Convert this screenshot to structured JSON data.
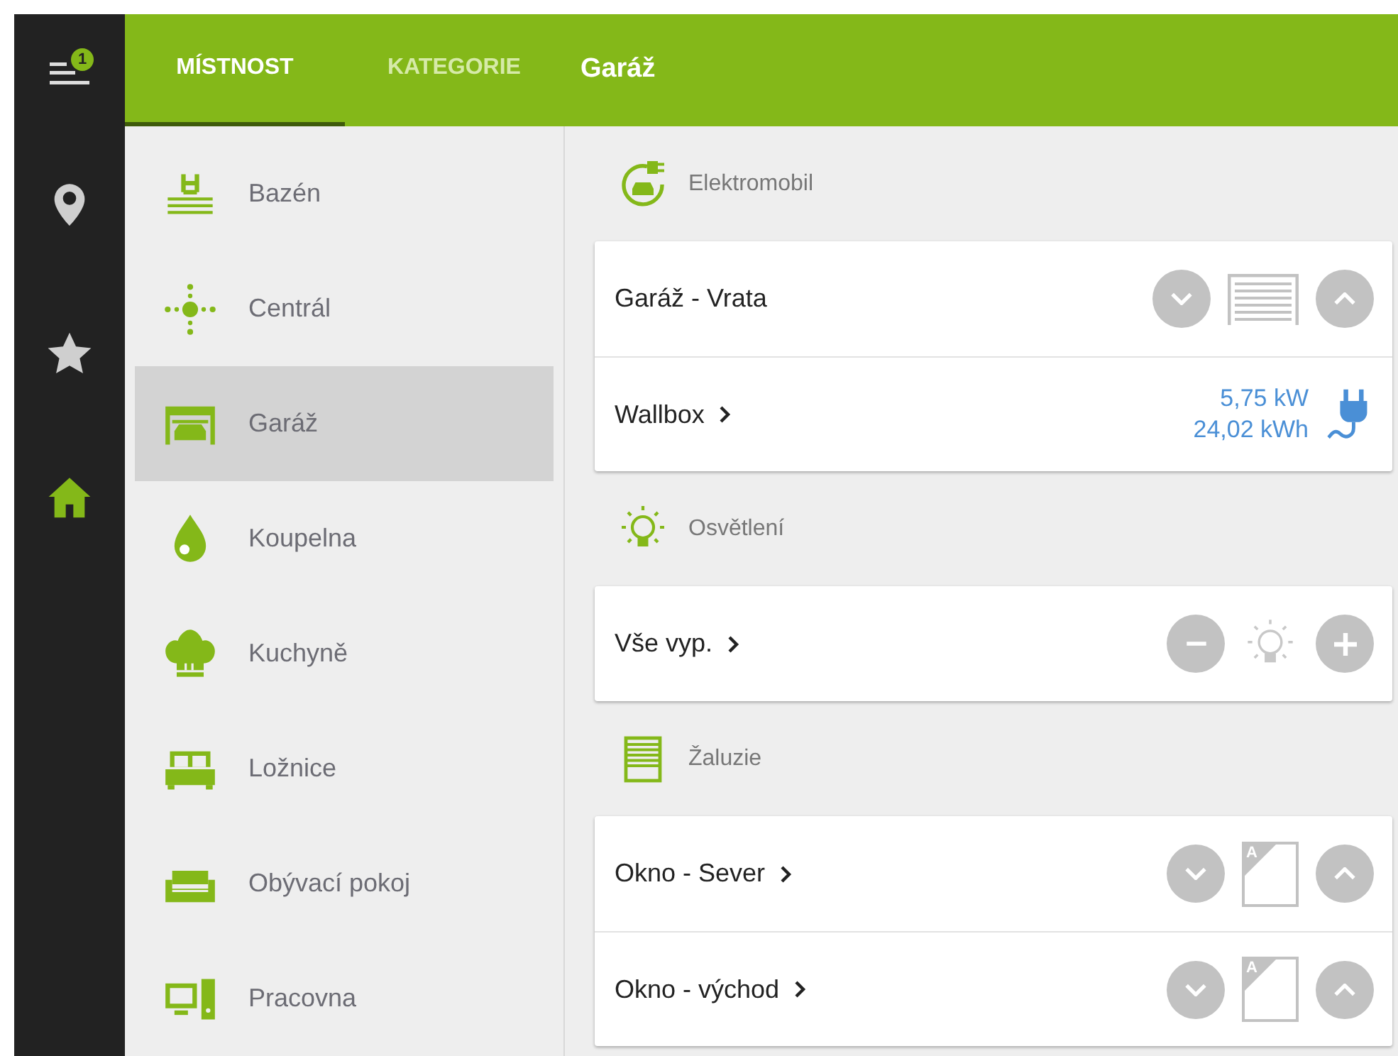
{
  "nav": {
    "badge": "1",
    "items": [
      {
        "selected": false
      },
      {
        "selected": false
      },
      {
        "selected": true
      }
    ]
  },
  "tabs": [
    {
      "label": "MÍSTNOST",
      "selected": true
    },
    {
      "label": "KATEGORIE",
      "selected": false
    }
  ],
  "title": "Garáž",
  "rooms": [
    {
      "label": "Bazén",
      "selected": false
    },
    {
      "label": "Centrál",
      "selected": false
    },
    {
      "label": "Garáž",
      "selected": true
    },
    {
      "label": "Koupelna",
      "selected": false
    },
    {
      "label": "Kuchyně",
      "selected": false
    },
    {
      "label": "Ložnice",
      "selected": false
    },
    {
      "label": "Obývací pokoj",
      "selected": false
    },
    {
      "label": "Pracovna",
      "selected": false
    }
  ],
  "sections": [
    {
      "title": "Elektromobil",
      "rows": [
        {
          "kind": "gate",
          "label": "Garáž - Vrata",
          "link": false
        },
        {
          "kind": "meter",
          "label": "Wallbox",
          "link": true,
          "readings": [
            "5,75 kW",
            "24,02 kWh"
          ]
        }
      ]
    },
    {
      "title": "Osvětlení",
      "rows": [
        {
          "kind": "light",
          "label": "Vše vyp.",
          "link": true
        }
      ]
    },
    {
      "title": "Žaluzie",
      "rows": [
        {
          "kind": "blind",
          "label": "Okno - Sever",
          "link": true,
          "mode": "A"
        },
        {
          "kind": "blind",
          "label": "Okno - východ",
          "link": true,
          "mode": "A"
        }
      ]
    }
  ]
}
